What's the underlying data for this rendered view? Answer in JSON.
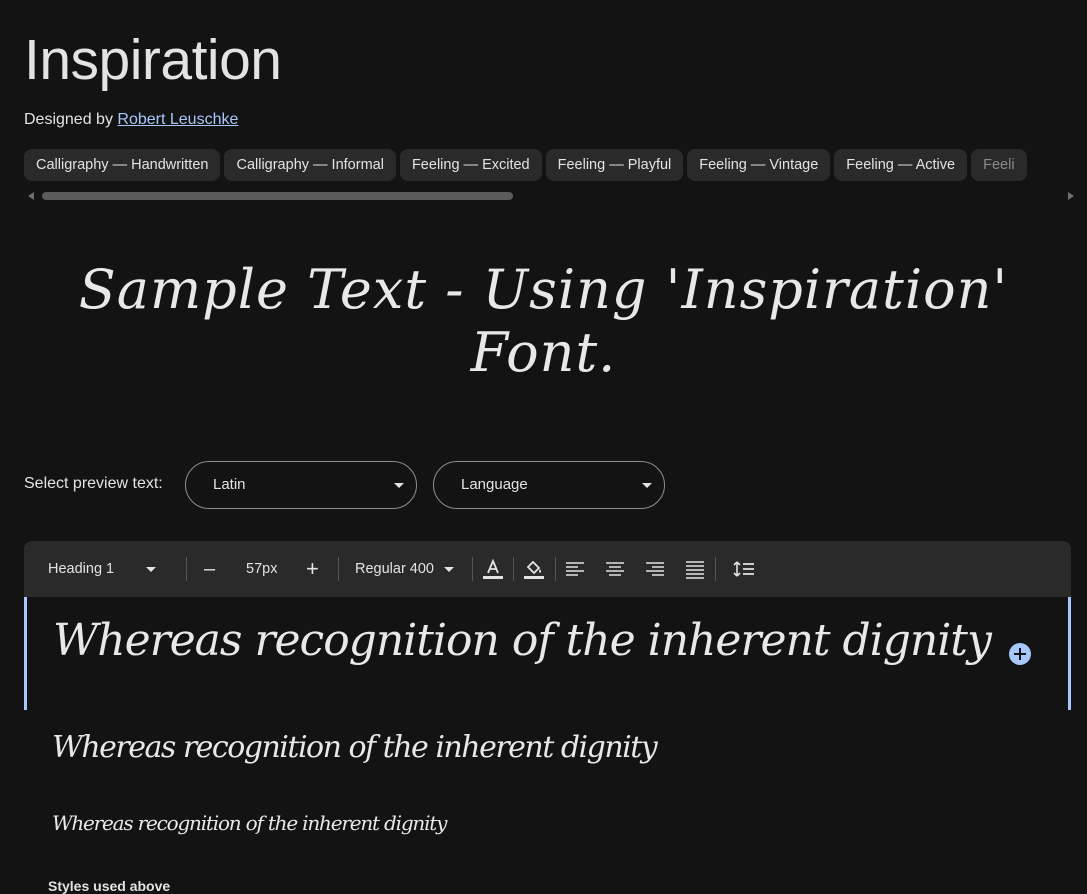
{
  "font": {
    "name": "Inspiration",
    "designed_by_prefix": "Designed by",
    "designer": "Robert Leuschke"
  },
  "tags": [
    "Calligraphy — Handwritten",
    "Calligraphy — Informal",
    "Feeling — Excited",
    "Feeling — Playful",
    "Feeling — Vintage",
    "Feeling — Active",
    "Feeli"
  ],
  "hero_text": "Sample Text - Using 'Inspiration' Font.",
  "preview": {
    "label": "Select preview text:",
    "script_value": "Latin",
    "language_value": "Language"
  },
  "toolbar": {
    "style_value": "Heading 1",
    "size_value": "57px",
    "weight_value": "Regular 400",
    "minus": "–",
    "plus": "+"
  },
  "samples": {
    "heading1": "Whereas recognition of the inherent dignity",
    "heading2": "Whereas recognition of the inherent dignity",
    "heading3": "Whereas recognition of the inherent dignity"
  },
  "styles_used_label": "Styles used above",
  "colors": {
    "background": "#131313",
    "accent": "#a8c7fa",
    "chip_bg": "#2a2a2a"
  }
}
